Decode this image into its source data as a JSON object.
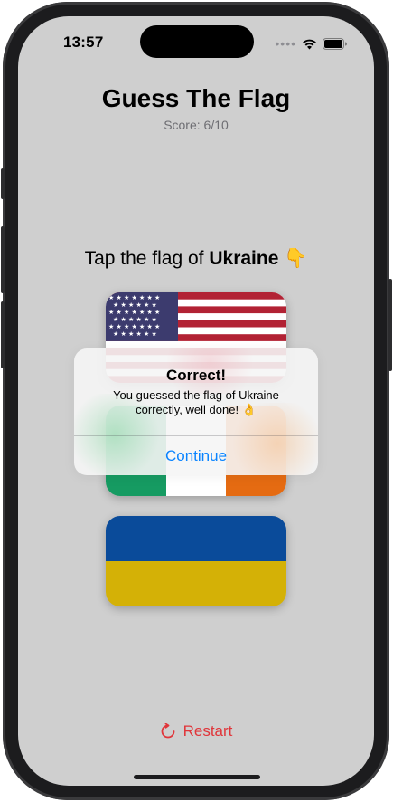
{
  "status_bar": {
    "time": "13:57",
    "signal": "••••"
  },
  "header": {
    "title": "Guess The Flag",
    "score": "Score: 6/10"
  },
  "prompt": {
    "prefix": "Tap the flag of",
    "country": "Ukraine",
    "emoji": "👇"
  },
  "flags": [
    {
      "name": "United States"
    },
    {
      "name": "Ireland"
    },
    {
      "name": "Ukraine"
    }
  ],
  "alert": {
    "title": "Correct!",
    "message": "You guessed the flag of Ukraine correctly, well done! 👌",
    "button": "Continue"
  },
  "footer": {
    "restart_label": "Restart"
  },
  "colors": {
    "background": "#cfcfcf",
    "accent": "#0a84ff",
    "destructive": "#e0353a",
    "us_red": "#b22234",
    "us_blue": "#3c3b6e",
    "ie_green": "#169b62",
    "ie_orange": "#ff883e",
    "ua_blue": "#0057b7",
    "ua_yellow": "#ffd700"
  }
}
